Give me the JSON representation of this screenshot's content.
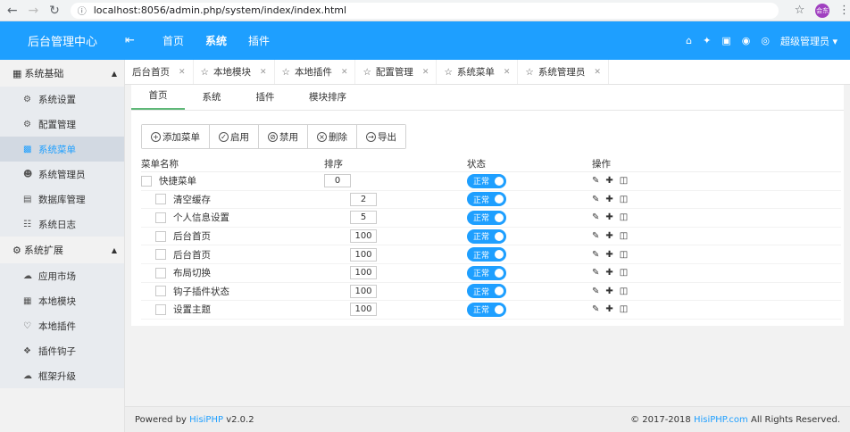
{
  "browser": {
    "url": "localhost:8056/admin.php/system/index/index.html",
    "profile_label": "会东"
  },
  "header": {
    "logo": "后台管理中心",
    "nav": [
      "首页",
      "系统",
      "插件"
    ],
    "user": "超级管理员"
  },
  "sidebar": {
    "groups": [
      {
        "title": "系统基础",
        "items": [
          {
            "label": "系统设置",
            "icon": "gear-icon"
          },
          {
            "label": "配置管理",
            "icon": "cogs-icon"
          },
          {
            "label": "系统菜单",
            "icon": "grid-icon",
            "active": true
          },
          {
            "label": "系统管理员",
            "icon": "user-icon"
          },
          {
            "label": "数据库管理",
            "icon": "database-icon"
          },
          {
            "label": "系统日志",
            "icon": "log-icon"
          }
        ]
      },
      {
        "title": "系统扩展",
        "items": [
          {
            "label": "应用市场",
            "icon": "cloud-icon"
          },
          {
            "label": "本地模块",
            "icon": "module-icon"
          },
          {
            "label": "本地插件",
            "icon": "plugin-icon"
          },
          {
            "label": "插件钩子",
            "icon": "hook-icon"
          },
          {
            "label": "框架升级",
            "icon": "upgrade-icon"
          }
        ]
      }
    ]
  },
  "tabs": [
    "后台首页",
    "本地模块",
    "本地插件",
    "配置管理",
    "系统菜单",
    "系统管理员"
  ],
  "subtabs": [
    "首页",
    "系统",
    "插件",
    "模块排序"
  ],
  "toolbar": {
    "add": "添加菜单",
    "enable": "启用",
    "disable": "禁用",
    "delete": "删除",
    "export": "导出"
  },
  "table": {
    "headers": {
      "name": "菜单名称",
      "sort": "排序",
      "status": "状态",
      "ops": "操作"
    },
    "status_label": "正常",
    "rows": [
      {
        "name": "快捷菜单",
        "sort": "0",
        "level": 0
      },
      {
        "name": "清空缓存",
        "sort": "2",
        "level": 1
      },
      {
        "name": "个人信息设置",
        "sort": "5",
        "level": 1
      },
      {
        "name": "后台首页",
        "sort": "100",
        "level": 1
      },
      {
        "name": "后台首页",
        "sort": "100",
        "level": 1
      },
      {
        "name": "布局切换",
        "sort": "100",
        "level": 1
      },
      {
        "name": "钩子插件状态",
        "sort": "100",
        "level": 1
      },
      {
        "name": "设置主题",
        "sort": "100",
        "level": 1
      }
    ]
  },
  "footer": {
    "powered_prefix": "Powered by ",
    "powered_link": "HisiPHP",
    "powered_version": " v2.0.2",
    "copy_prefix": "© 2017-2018 ",
    "copy_link": "HisiPHP.com",
    "copy_suffix": " All Rights Reserved."
  },
  "colors": {
    "accent": "#1e9fff",
    "subtab_active": "#5fb878"
  }
}
